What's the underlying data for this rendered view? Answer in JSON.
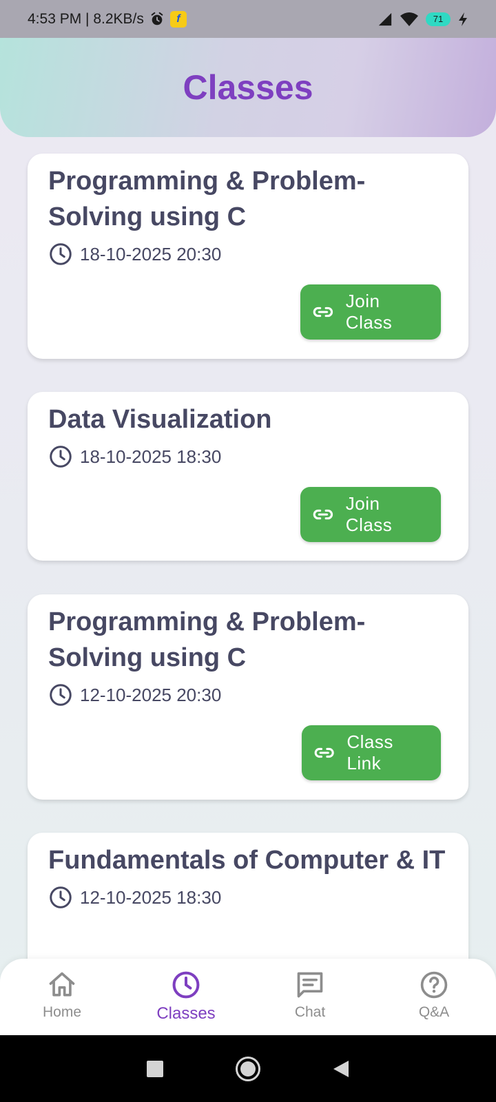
{
  "status_bar": {
    "time_speed": "4:53 PM | 8.2KB/s",
    "app_badge": "f",
    "battery_level": "71"
  },
  "header": {
    "title": "Classes"
  },
  "classes": [
    {
      "title": "Programming & Problem-Solving using C",
      "datetime": "18-10-2025 20:30",
      "button_label": "Join Class"
    },
    {
      "title": "Data Visualization",
      "datetime": "18-10-2025 18:30",
      "button_label": "Join Class"
    },
    {
      "title": "Programming & Problem-Solving using C",
      "datetime": "12-10-2025 20:30",
      "button_label": "Class Link"
    },
    {
      "title": "Fundamentals of Computer & IT",
      "datetime": "12-10-2025 18:30"
    }
  ],
  "bottom_nav": {
    "items": [
      {
        "label": "Home",
        "icon": "home-icon"
      },
      {
        "label": "Classes",
        "icon": "clock-icon",
        "active": true
      },
      {
        "label": "Chat",
        "icon": "chat-icon"
      },
      {
        "label": "Q&A",
        "icon": "help-icon"
      }
    ]
  },
  "colors": {
    "accent": "#7e3fc0",
    "button_green": "#4caf50",
    "text_dark": "#474863",
    "nav_inactive": "#8d8d8d"
  }
}
